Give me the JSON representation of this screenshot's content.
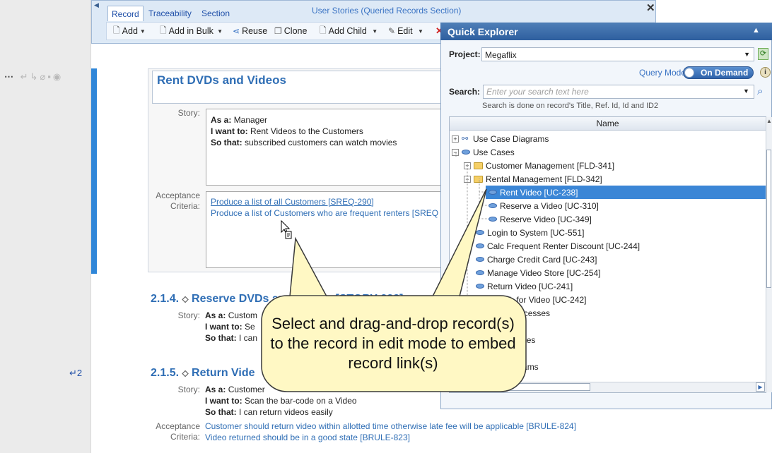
{
  "toolbar": {
    "tabs": [
      "Record",
      "Traceability",
      "Section"
    ],
    "section_title": "User Stories (Queried Records Section)",
    "buttons": {
      "add": "Add",
      "add_bulk": "Add in Bulk",
      "reuse": "Reuse",
      "clone": "Clone",
      "add_child": "Add Child",
      "edit": "Edit"
    }
  },
  "gutter": {
    "line_number": "2"
  },
  "record": {
    "title": "Rent DVDs and Videos",
    "story_label": "Story:",
    "acceptance_label": "Acceptance Criteria:",
    "as_a_label": "As a:",
    "as_a": "Manager",
    "want_label": "I want to:",
    "want": "Rent Videos to the Customers",
    "so_label": "So that:",
    "so": "subscribed customers can watch movies",
    "criteria": [
      "Produce a list of all Customers [SREQ-290]",
      "Produce a list of Customers who are frequent renters [SREQ"
    ]
  },
  "sections": [
    {
      "number": "2.1.4.",
      "title": "Reserve DVDs and Videos [STORY-223]",
      "story": {
        "as_a": "Custom",
        "want": "Se",
        "so": "I can"
      }
    },
    {
      "number": "2.1.5.",
      "title": "Return Vide",
      "story": {
        "as_a": "Customer",
        "want": "Scan the bar-code on a Video",
        "so": "I can return videos easily"
      },
      "criteria": [
        "Customer should return video within allotted time otherwise late fee will be applicable [BRULE-824]",
        "Video returned should be in a good state [BRULE-823]"
      ]
    }
  ],
  "explorer": {
    "title": "Quick Explorer",
    "project_label": "Project:",
    "project_value": "Megaflix",
    "query_mode_label": "Query Mode:",
    "query_mode_value": "On Demand",
    "search_label": "Search:",
    "search_placeholder": "Enter your search text here",
    "search_hint": "Search is done on record's Title, Ref. Id, Id and ID2",
    "column_header": "Name",
    "tree": [
      {
        "label": "Use Case Diagrams",
        "toggle": "+",
        "icon": "diagram-icon",
        "level": 0
      },
      {
        "label": "Use Cases",
        "toggle": "−",
        "icon": "use-case-icon",
        "level": 0
      },
      {
        "label": "Customer Management [FLD-341]",
        "toggle": "+",
        "icon": "folder-icon",
        "level": 1
      },
      {
        "label": "Rental Management [FLD-342]",
        "toggle": "−",
        "icon": "folder-icon",
        "level": 1
      },
      {
        "label": "Rent Video [UC-238]",
        "icon": "use-case-icon",
        "level": 2,
        "selected": true
      },
      {
        "label": "Reserve a Video [UC-310]",
        "icon": "use-case-icon",
        "level": 2
      },
      {
        "label": "Reserve Video [UC-349]",
        "icon": "use-case-icon",
        "level": 2
      },
      {
        "label": "Login to System [UC-551]",
        "icon": "use-case-icon",
        "level": 1
      },
      {
        "label": "Calc Frequent Renter Discount [UC-244]",
        "icon": "use-case-icon",
        "level": 1
      },
      {
        "label": "Charge Credit Card [UC-243]",
        "icon": "use-case-icon",
        "level": 1
      },
      {
        "label": "Manage Video Store [UC-254]",
        "icon": "use-case-icon",
        "level": 1
      },
      {
        "label": "Return Video [UC-241]",
        "icon": "use-case-icon",
        "level": 1
      },
      {
        "label": "Search for Video [UC-242]",
        "icon": "use-case-icon",
        "level": 1
      },
      {
        "label": "Business Processes",
        "toggle": "+",
        "icon": "folder-icon",
        "level": 0
      },
      {
        "label": "",
        "level": 0
      },
      {
        "label": "Use Case Notes",
        "level": 0
      },
      {
        "label": "Actors",
        "level": 0
      },
      {
        "label": "Activity Diagrams",
        "level": 0
      },
      {
        "label": "Test Runs",
        "level": 0
      }
    ]
  },
  "callout": {
    "text": "Select and drag-and-drop record(s) to the record in edit mode to embed record link(s)"
  }
}
